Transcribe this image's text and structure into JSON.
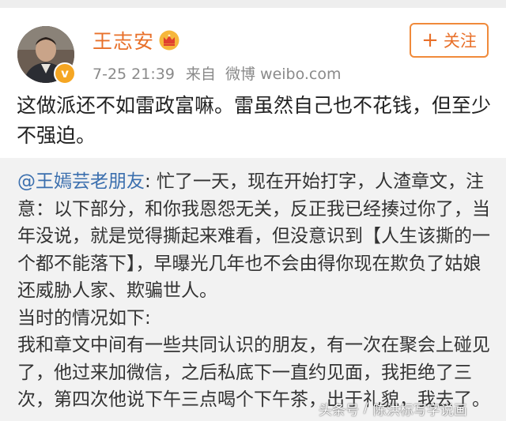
{
  "post": {
    "author": "王志安",
    "time": "7-25 21:39",
    "source_prefix": "来自",
    "source": "微博 weibo.com",
    "follow_label": "关注",
    "follow_plus": "+",
    "verified_mark": "v",
    "text": "这做派还不如雷政富嘛。雷虽然自己也不花钱，但至少不强迫。"
  },
  "repost": {
    "mention": "@王嫣芸老朋友",
    "body": ": 忙了一天，现在开始打字，人渣章文，注意：以下部分，和你我恩怨无关，反正我已经揍过你了，当年没说，就是觉得撕起来难看，但没意识到【人生该撕的一个都不能落下】，早曝光几年也不会由得你现在欺负了姑娘还威胁人家、欺骗世人。",
    "line2": "当时的情况如下:",
    "line3": "我和章文中间有一些共同认识的朋友，有一次在聚会上碰见了，他过来加微信，之后私底下一直约见面，我拒绝了三次，第四次他说下午三点喝个下午茶，出于礼貌，我去了。"
  },
  "watermark": {
    "left": "头条号",
    "separator": "/",
    "right": "陈洪标写字说画"
  },
  "colors": {
    "username": "#e8702a",
    "mention": "#3b6fae",
    "repost_bg": "#f2f2f2",
    "verified": "#f5a623"
  },
  "icons": [
    "avatar",
    "verified-icon",
    "crown-icon",
    "plus-icon"
  ]
}
